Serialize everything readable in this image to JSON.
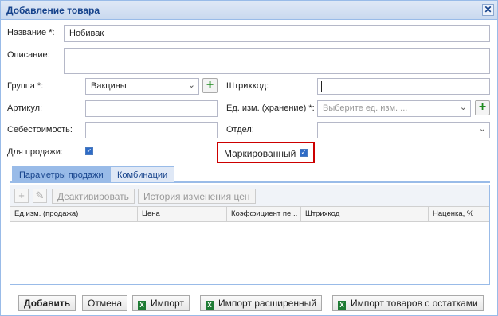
{
  "window": {
    "title": "Добавление товара",
    "close_icon": "✕"
  },
  "form": {
    "name_label": "Название *:",
    "name_value": "Нобивак",
    "description_label": "Описание:",
    "description_value": "",
    "group_label": "Группа *:",
    "group_value": "Вакцины",
    "barcode_label": "Штрихкод:",
    "barcode_value": "",
    "article_label": "Артикул:",
    "article_value": "",
    "unit_label": "Ед. изм. (хранение) *:",
    "unit_placeholder": "Выберите ед. изм. ...",
    "cost_label": "Себестоимость:",
    "cost_value": "",
    "department_label": "Отдел:",
    "department_value": "",
    "for_sale_label": "Для продажи:",
    "for_sale_checked": true,
    "marked_label": "Маркированный",
    "marked_checked": true
  },
  "tabs": [
    {
      "label": "Параметры продажи",
      "active": true
    },
    {
      "label": "Комбинации",
      "active": false
    }
  ],
  "toolbar": {
    "deactivate_label": "Деактивировать",
    "price_history_label": "История изменения цен"
  },
  "grid": {
    "columns": [
      "Ед.изм. (продажа)",
      "Цена",
      "Коэффициент пе...",
      "Штрихкод",
      "Наценка, %"
    ],
    "rows": []
  },
  "footer": {
    "add_label": "Добавить",
    "cancel_label": "Отмена",
    "import_label": "Импорт",
    "import_ext_label": "Импорт расширенный",
    "import_stock_label": "Импорт товаров с остатками"
  },
  "colors": {
    "accent": "#99bbe8",
    "title_text": "#15428b",
    "highlight": "#cc0000",
    "add_green": "#1e8a1e"
  }
}
